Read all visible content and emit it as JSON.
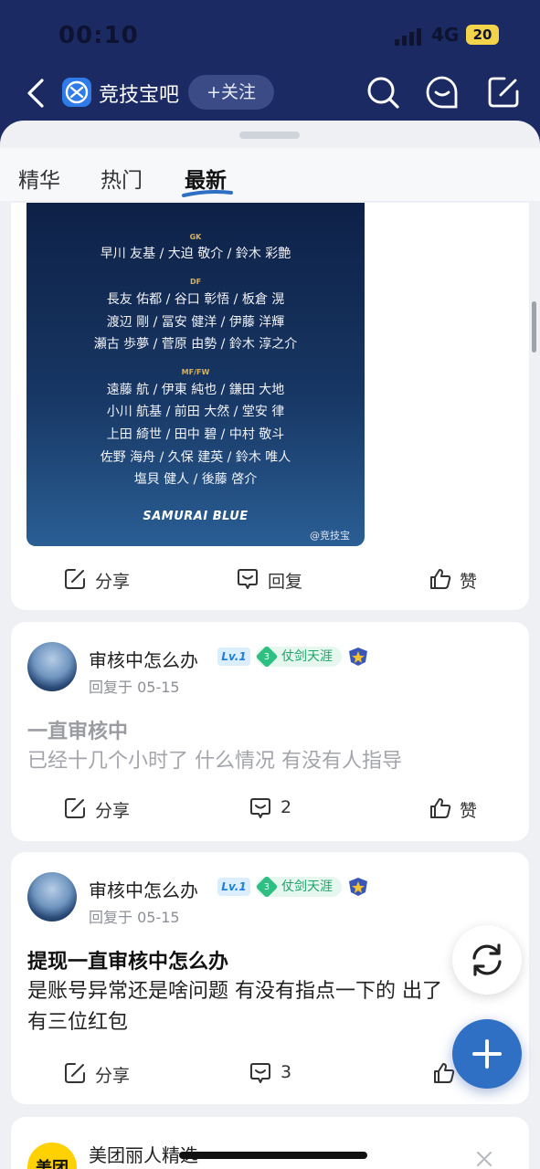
{
  "status": {
    "time": "00:10",
    "network": "4G",
    "battery": "20"
  },
  "header": {
    "title": "竞技宝吧",
    "follow_label": "+关注"
  },
  "tabs": [
    {
      "label": "精华"
    },
    {
      "label": "热门"
    },
    {
      "label": "最新"
    }
  ],
  "poster": {
    "sections": [
      {
        "label": "GK",
        "lines": [
          "早川 友基 / 大迫 敬介 / 鈴木 彩艶"
        ]
      },
      {
        "label": "DF",
        "lines": [
          "長友 佑都 / 谷口 彰悟 / 板倉 滉",
          "渡辺 剛 / 冨安 健洋 / 伊藤 洋輝",
          "瀬古 歩夢 / 菅原 由勢 / 鈴木 淳之介"
        ]
      },
      {
        "label": "MF/FW",
        "lines": [
          "遠藤 航 / 伊東 純也 / 鎌田 大地",
          "小川 航基 / 前田 大然 / 堂安 律",
          "上田 綺世 / 田中 碧 / 中村 敬斗",
          "佐野 海舟 / 久保 建英 / 鈴木 唯人",
          "塩貝 健人 / 後藤 啓介"
        ]
      }
    ],
    "brand": "SAMURAI BLUE",
    "watermark": "@竞技宝"
  },
  "posts": [
    {
      "actions": {
        "share": "分享",
        "reply": "回复",
        "like": "赞"
      }
    },
    {
      "user": "审核中怎么办",
      "level": "Lv.1",
      "badge_num": "3",
      "badge": "仗剑天涯",
      "meta": "回复于 05-15",
      "title": "一直审核中",
      "body": "已经十几个小时了 什么情况 有没有人指导",
      "actions": {
        "share": "分享",
        "reply": "2",
        "like": "赞"
      }
    },
    {
      "user": "审核中怎么办",
      "level": "Lv.1",
      "badge_num": "3",
      "badge": "仗剑天涯",
      "meta": "回复于 05-15",
      "title": "提现一直审核中怎么办",
      "body": "是账号异常还是啥问题 有没有指点一下的 出了有三位红包",
      "actions": {
        "share": "分享",
        "reply": "3",
        "like": ""
      }
    }
  ],
  "ad": {
    "logo": "美团",
    "name": "美团丽人精选"
  }
}
